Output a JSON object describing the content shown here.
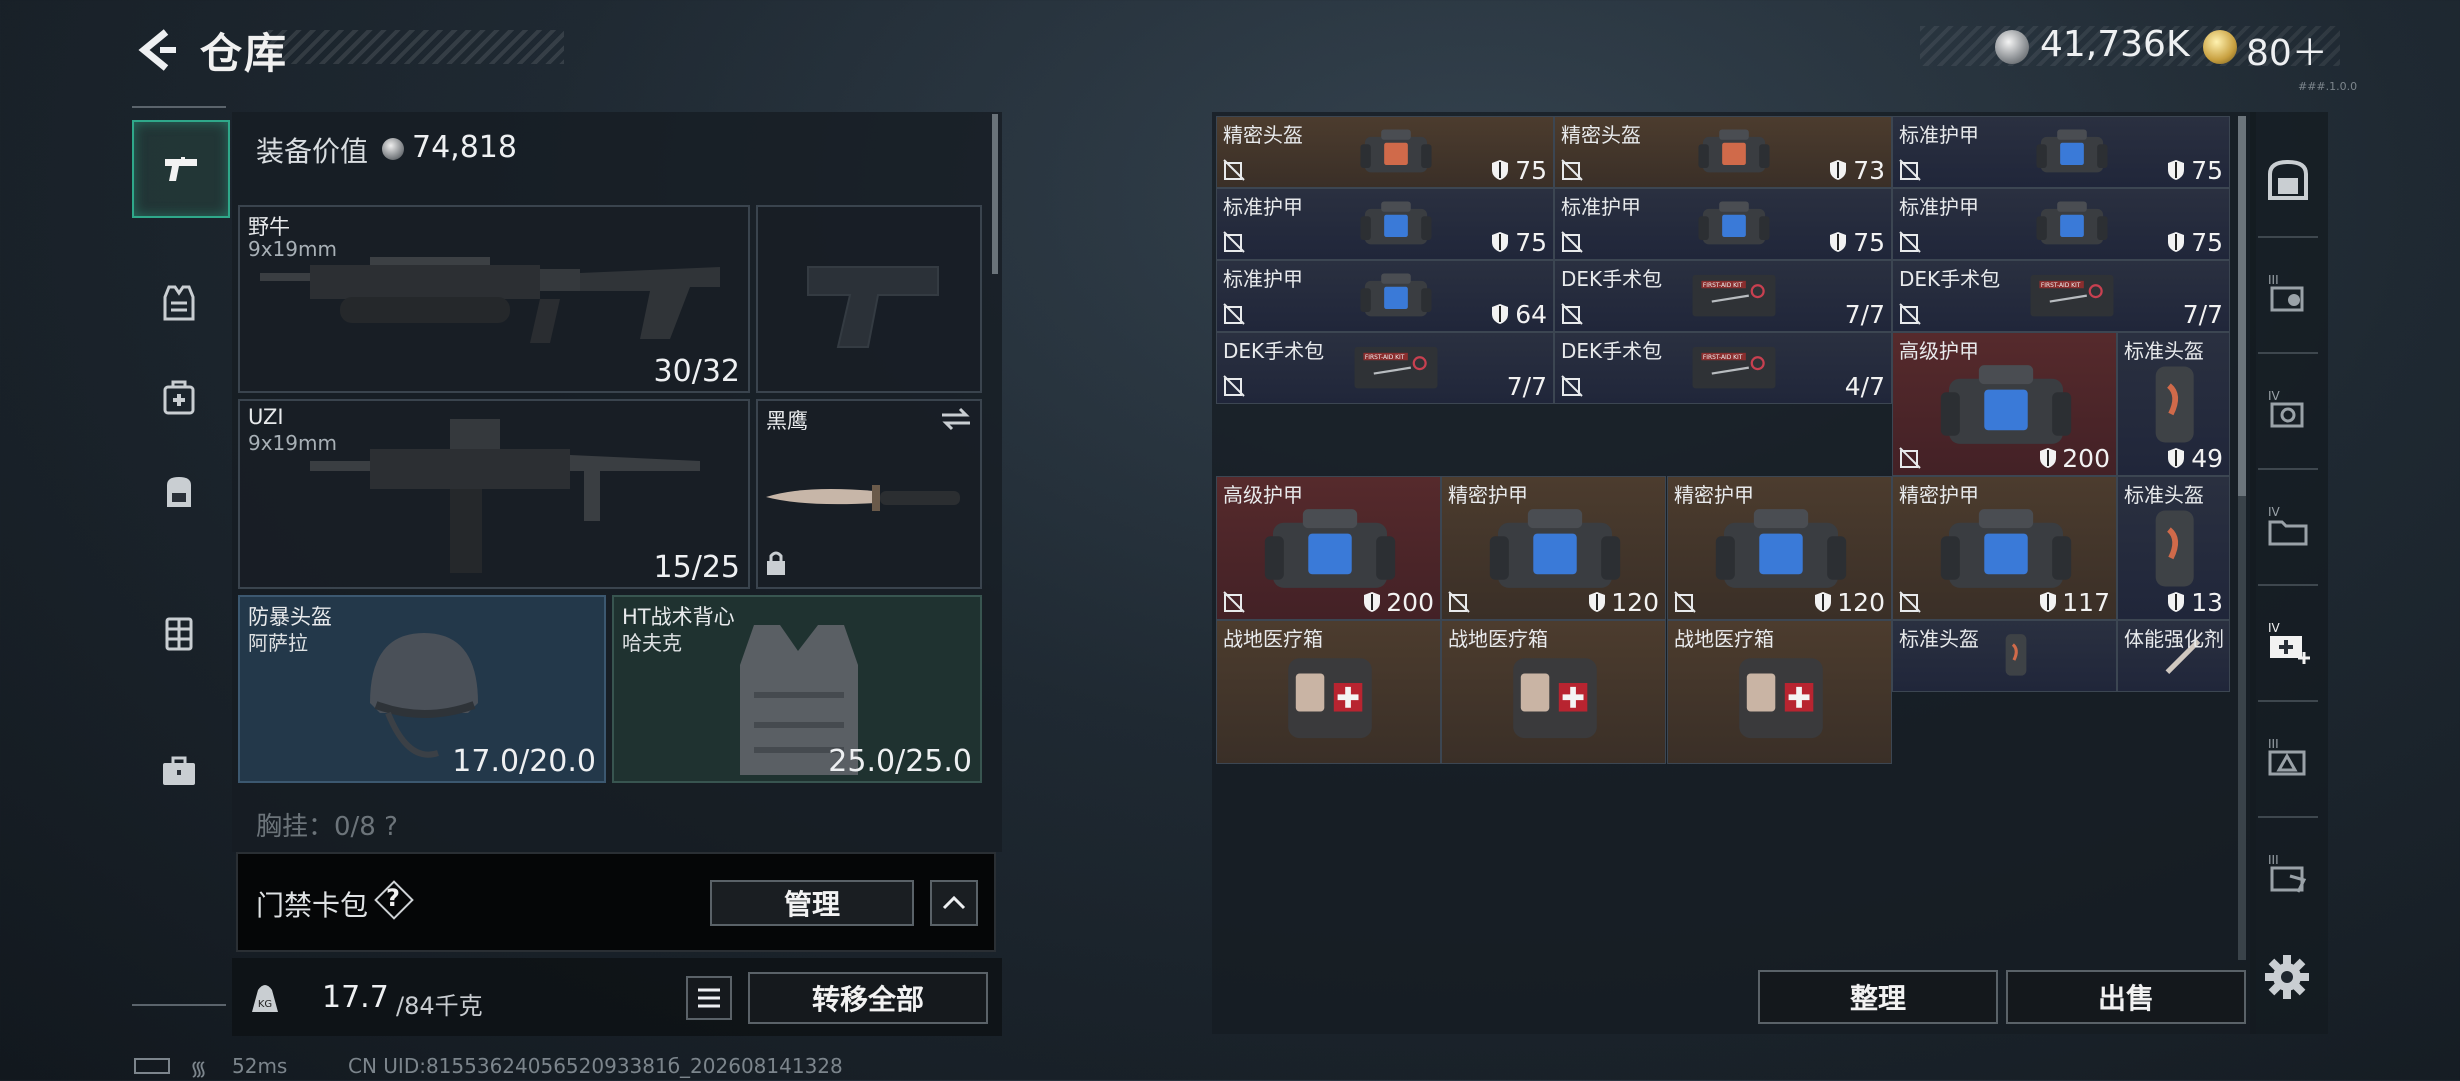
{
  "header": {
    "title": "仓库",
    "money": "41,736K",
    "gold": "80＋",
    "version": "###.1.0.0"
  },
  "categories": [
    {
      "name": "weapons",
      "icon": "pistol-icon",
      "active": true
    },
    {
      "name": "armor",
      "icon": "vest-icon"
    },
    {
      "name": "medical",
      "icon": "medkit-icon"
    },
    {
      "name": "backpack",
      "icon": "backpack-icon"
    },
    {
      "name": "rig",
      "icon": "rig-icon"
    },
    {
      "name": "case",
      "icon": "briefcase-icon"
    }
  ],
  "loadout": {
    "value_label": "装备价值",
    "value": "74,818",
    "primary": {
      "name": "野牛",
      "ammo": "9x19mm",
      "count": "30/32"
    },
    "sidearm": {
      "name": "",
      "count": ""
    },
    "secondary": {
      "name": "UZI",
      "ammo": "9x19mm",
      "count": "15/25"
    },
    "melee": {
      "name": "黑鹰"
    },
    "helmet": {
      "type": "防暴头盔",
      "name": "阿萨拉",
      "durability": "17.0/20.0"
    },
    "vest": {
      "type": "HT战术背心",
      "name": "哈夫克",
      "durability": "25.0/25.0"
    },
    "chest_row": "胸挂：0/8  ?"
  },
  "keycard": {
    "label": "门禁卡包",
    "help": "?",
    "manage": "管理"
  },
  "weight": {
    "current": "17.7",
    "max": "/84千克"
  },
  "transfer_all": "转移全部",
  "status": {
    "ping": "52ms",
    "uid": "CN UID:8155362405652093381б_202608141328"
  },
  "stash": {
    "items": [
      {
        "name": "精密头盔",
        "value": "75",
        "color": "gold",
        "art": "bag-red"
      },
      {
        "name": "精密头盔",
        "value": "73",
        "color": "gold",
        "art": "bag-red"
      },
      {
        "name": "标准护甲",
        "value": "75",
        "color": "navy",
        "art": "bag-blue"
      },
      {
        "name": "标准护甲",
        "value": "75",
        "color": "navy",
        "art": "bag-blue"
      },
      {
        "name": "标准护甲",
        "value": "75",
        "color": "navy",
        "art": "bag-blue"
      },
      {
        "name": "标准护甲",
        "value": "75",
        "color": "navy",
        "art": "bag-blue"
      },
      {
        "name": "标准护甲",
        "value": "64",
        "color": "navy",
        "art": "bag-blue"
      },
      {
        "name": "DEK手术包",
        "value": "7/7",
        "color": "navy",
        "art": "kit"
      },
      {
        "name": "DEK手术包",
        "value": "7/7",
        "color": "navy",
        "art": "kit"
      },
      {
        "name": "DEK手术包",
        "value": "7/7",
        "color": "navy",
        "art": "kit"
      },
      {
        "name": "DEK手术包",
        "value": "4/7",
        "color": "navy",
        "art": "kit"
      },
      {
        "name": "高级护甲",
        "value": "200",
        "color": "red",
        "art": "bag-big"
      },
      {
        "name": "标准头盔",
        "value": "49",
        "color": "navy",
        "art": "helm"
      },
      {
        "name": "高级护甲",
        "value": "200",
        "color": "red",
        "art": "bag-big"
      },
      {
        "name": "精密护甲",
        "value": "120",
        "color": "gold",
        "art": "bag-blue"
      },
      {
        "name": "精密护甲",
        "value": "120",
        "color": "gold",
        "art": "bag-blue"
      },
      {
        "name": "精密护甲",
        "value": "117",
        "color": "gold",
        "art": "bag-big"
      },
      {
        "name": "标准头盔",
        "value": "13",
        "color": "navy",
        "art": "helm"
      },
      {
        "name": "战地医疗箱",
        "value": "",
        "color": "gold",
        "art": "medbox"
      },
      {
        "name": "战地医疗箱",
        "value": "",
        "color": "gold",
        "art": "medbox"
      },
      {
        "name": "战地医疗箱",
        "value": "",
        "color": "gold",
        "art": "medbox"
      },
      {
        "name": "标准头盔",
        "value": "",
        "color": "navy",
        "art": "helm"
      },
      {
        "name": "体能强化剂",
        "value": "",
        "color": "navy",
        "art": "syringe"
      }
    ]
  },
  "actions": {
    "tidy": "整理",
    "sell": "出售"
  },
  "tabs": [
    {
      "icon": "safe-box-icon"
    },
    {
      "icon": "container-iii-icon",
      "level": "III"
    },
    {
      "icon": "container-iv-icon",
      "level": "IV"
    },
    {
      "icon": "container-iv-folder-icon",
      "level": "IV"
    },
    {
      "icon": "container-iv-medical-icon",
      "level": "IV",
      "active": true
    },
    {
      "icon": "container-iii-warning-icon",
      "level": "III"
    },
    {
      "icon": "container-iii-hand-icon",
      "level": "III"
    }
  ],
  "colors": {
    "accent": "#2fa88a",
    "gold_cell": "#4c3c2e",
    "navy_cell": "#2a3040",
    "red_cell": "#562a2c"
  }
}
